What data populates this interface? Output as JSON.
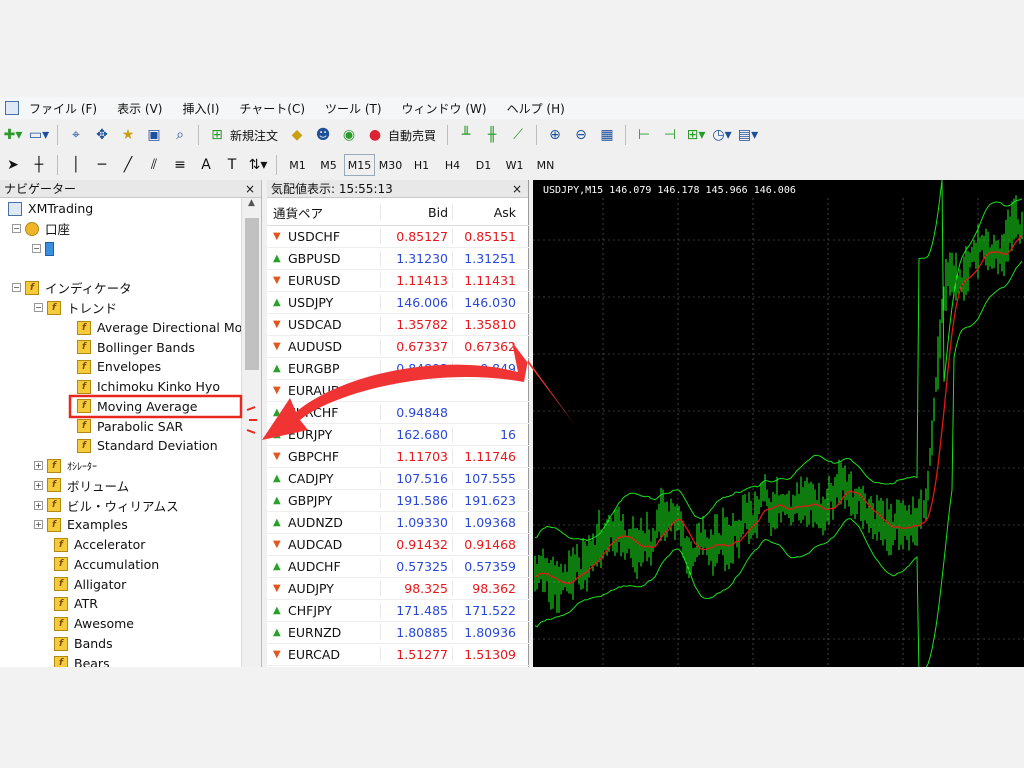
{
  "menu": [
    "ファイル (F)",
    "表示 (V)",
    "挿入(I)",
    "チャート(C)",
    "ツール (T)",
    "ウィンドウ (W)",
    "ヘルプ (H)"
  ],
  "toolbar": {
    "new_order": "新規注文",
    "auto_trade": "自動売買",
    "text_tool": "A"
  },
  "timeframes": [
    "M1",
    "M5",
    "M15",
    "M30",
    "H1",
    "H4",
    "D1",
    "W1",
    "MN"
  ],
  "active_timeframe": "M15",
  "navigator": {
    "title": "ナビゲーター",
    "close": "×",
    "root": "XMTrading",
    "account": "口座",
    "indicators": "インディケータ",
    "trend": "トレンド",
    "trend_items": [
      "Average Directional Movement Index",
      "Bollinger Bands",
      "Envelopes",
      "Ichimoku Kinko Hyo",
      "Moving Average",
      "Parabolic SAR",
      "Standard Deviation"
    ],
    "groups": [
      "ｵｼﾚｰﾀｰ",
      "ボリューム",
      "ビル・ウィリアムス",
      "Examples"
    ],
    "items": [
      "Accelerator",
      "Accumulation",
      "Alligator",
      "ATR",
      "Awesome",
      "Bands",
      "Bears"
    ]
  },
  "market_watch": {
    "title": "気配値表示: 15:55:13",
    "close": "×",
    "col_symbol": "通貨ペア",
    "col_bid": "Bid",
    "col_ask": "Ask",
    "rows": [
      {
        "s": "USDCHF",
        "d": "down",
        "b": "0.85127",
        "a": "0.85151",
        "c": "red"
      },
      {
        "s": "GBPUSD",
        "d": "up",
        "b": "1.31230",
        "a": "1.31251",
        "c": "blue"
      },
      {
        "s": "EURUSD",
        "d": "down",
        "b": "1.11413",
        "a": "1.11431",
        "c": "red"
      },
      {
        "s": "USDJPY",
        "d": "up",
        "b": "146.006",
        "a": "146.030",
        "c": "blue"
      },
      {
        "s": "USDCAD",
        "d": "down",
        "b": "1.35782",
        "a": "1.35810",
        "c": "red"
      },
      {
        "s": "AUDUSD",
        "d": "down",
        "b": "0.67337",
        "a": "0.67362",
        "c": "red"
      },
      {
        "s": "EURGBP",
        "d": "up",
        "b": "0.84893",
        "a": "0.849",
        "c": "blue"
      },
      {
        "s": "EURAUD",
        "d": "down",
        "b": "",
        "a": "",
        "c": "red"
      },
      {
        "s": "EURCHF",
        "d": "up",
        "b": "0.94848",
        "a": "",
        "c": "blue"
      },
      {
        "s": "EURJPY",
        "d": "up",
        "b": "162.680",
        "a": "16",
        "c": "blue"
      },
      {
        "s": "GBPCHF",
        "d": "down",
        "b": "1.11703",
        "a": "1.11746",
        "c": "red"
      },
      {
        "s": "CADJPY",
        "d": "up",
        "b": "107.516",
        "a": "107.555",
        "c": "blue"
      },
      {
        "s": "GBPJPY",
        "d": "up",
        "b": "191.586",
        "a": "191.623",
        "c": "blue"
      },
      {
        "s": "AUDNZD",
        "d": "up",
        "b": "1.09330",
        "a": "1.09368",
        "c": "blue"
      },
      {
        "s": "AUDCAD",
        "d": "down",
        "b": "0.91432",
        "a": "0.91468",
        "c": "red"
      },
      {
        "s": "AUDCHF",
        "d": "up",
        "b": "0.57325",
        "a": "0.57359",
        "c": "blue"
      },
      {
        "s": "AUDJPY",
        "d": "down",
        "b": "98.325",
        "a": "98.362",
        "c": "red"
      },
      {
        "s": "CHFJPY",
        "d": "up",
        "b": "171.485",
        "a": "171.522",
        "c": "blue"
      },
      {
        "s": "EURNZD",
        "d": "up",
        "b": "1.80885",
        "a": "1.80936",
        "c": "blue"
      },
      {
        "s": "EURCAD",
        "d": "down",
        "b": "1.51277",
        "a": "1.51309",
        "c": "red"
      }
    ]
  },
  "chart": {
    "title": "USDJPY,M15  146.079 146.178 145.966 146.006"
  },
  "colors": {
    "highlight_box": "#e8281e",
    "annotation_arrow": "#f03434",
    "candles": "#19e019",
    "ma_line": "#e01818"
  }
}
